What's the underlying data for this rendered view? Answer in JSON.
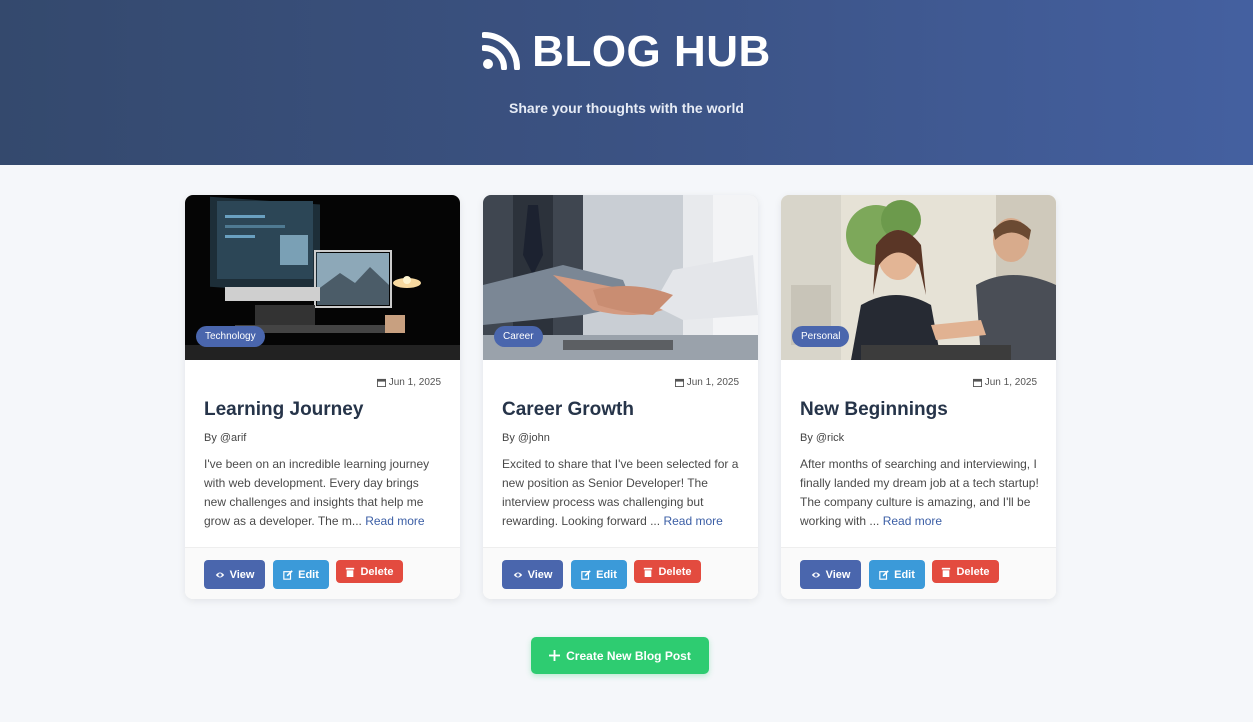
{
  "header": {
    "title": "BLOG HUB",
    "tagline": "Share your thoughts with the world",
    "icon": "rss-icon"
  },
  "posts": [
    {
      "category": "Technology",
      "date": "Jun 1, 2025",
      "title": "Learning Journey",
      "author": "By @arif",
      "excerpt": "I've been on an incredible learning journey with web development. Every day brings new challenges and insights that help me grow as a developer. The m...",
      "read_more": "Read more"
    },
    {
      "category": "Career",
      "date": "Jun 1, 2025",
      "title": "Career Growth",
      "author": "By @john",
      "excerpt": "Excited to share that I've been selected for a new position as Senior Developer! The interview process was challenging but rewarding. Looking forward ...",
      "read_more": "Read more"
    },
    {
      "category": "Personal",
      "date": "Jun 1, 2025",
      "title": "New Beginnings",
      "author": "By @rick",
      "excerpt": "After months of searching and interviewing, I finally landed my dream job at a tech startup! The company culture is amazing, and I'll be working with ...",
      "read_more": "Read more"
    }
  ],
  "actions": {
    "view": "View",
    "edit": "Edit",
    "delete": "Delete"
  },
  "create_button": "Create New Blog Post",
  "colors": {
    "primary": "#4a66ad",
    "edit": "#3b9ad9",
    "delete": "#e34b3f",
    "create": "#2ecc71"
  }
}
